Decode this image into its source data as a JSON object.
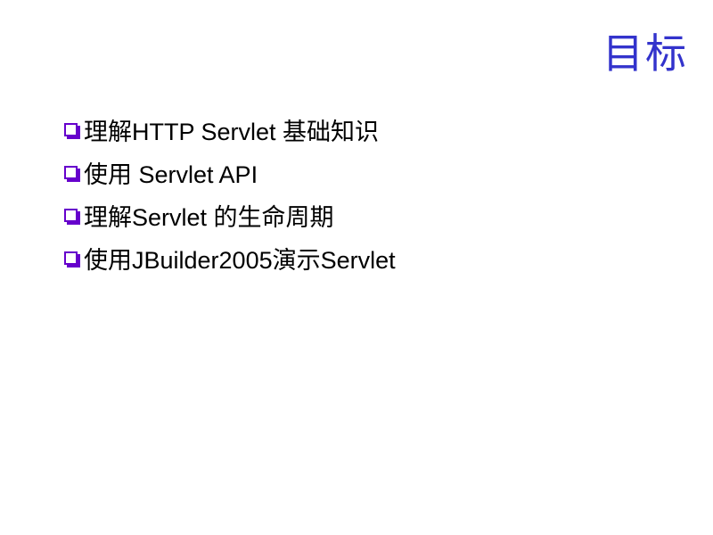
{
  "slide": {
    "title": "目标",
    "colors": {
      "title": "#3333cc",
      "bullet": "#6600cc",
      "text": "#000000",
      "background": "#ffffff"
    },
    "bullet_icon": "hollow-square-shadow-icon",
    "bullets": [
      {
        "text": "理解HTTP Servlet 基础知识"
      },
      {
        "text": "使用 Servlet API"
      },
      {
        "text": "理解Servlet 的生命周期"
      },
      {
        "text": "使用JBuilder2005演示Servlet"
      }
    ]
  }
}
